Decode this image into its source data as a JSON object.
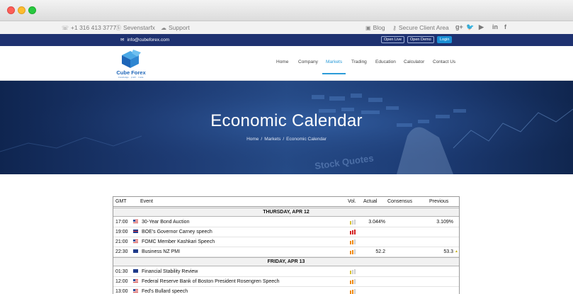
{
  "topbar": {
    "phone": "+1 316 413 3777",
    "skype": "Sevenstarfx",
    "support": "Support",
    "blog": "Blog",
    "secure": "Secure Client Area",
    "social": [
      "g+",
      "twitter-icon",
      "youtube-icon",
      "in",
      "f"
    ]
  },
  "bluebar": {
    "email": "info@cubeforex.com",
    "open_live": "Open Live",
    "open_demo": "Open Demo",
    "login": "Login"
  },
  "logo": {
    "name": "Cube Forex",
    "tagline": "knowledge · profit · trade"
  },
  "nav": [
    "Home",
    "Company",
    "Markets",
    "Trading",
    "Education",
    "Calculator",
    "Contact Us"
  ],
  "nav_active": "Markets",
  "hero": {
    "title": "Economic Calendar",
    "breadcrumb": [
      "Home",
      "Markets",
      "Economic Calendar"
    ],
    "bg_text": "Stock Quotes"
  },
  "calendar": {
    "headers": [
      "GMT",
      "Event",
      "Vol.",
      "Actual",
      "Consensus",
      "Previous"
    ],
    "days": [
      {
        "label": "THURSDAY, APR 12",
        "events": [
          {
            "time": "17:00",
            "flag": "us",
            "event": "30-Year Bond Auction",
            "vol": "low",
            "actual": "3.044%",
            "consensus": "",
            "previous": "3.109%"
          },
          {
            "time": "19:00",
            "flag": "gb",
            "event": "BOE's Governor Carney speech",
            "vol": "high",
            "actual": "",
            "consensus": "",
            "previous": ""
          },
          {
            "time": "21:00",
            "flag": "us",
            "event": "FOMC Member Kashkari Speech",
            "vol": "medium",
            "actual": "",
            "consensus": "",
            "previous": ""
          },
          {
            "time": "22:30",
            "flag": "nz",
            "event": "Business NZ PMI",
            "vol": "medium",
            "actual": "52.2",
            "consensus": "",
            "previous": "53.3"
          }
        ]
      },
      {
        "label": "FRIDAY, APR 13",
        "events": [
          {
            "time": "01:30",
            "flag": "au",
            "event": "Financial Stability Review",
            "vol": "low",
            "actual": "",
            "consensus": "",
            "previous": ""
          },
          {
            "time": "12:00",
            "flag": "us",
            "event": "Federal Reserve Bank of Boston President Rosengren Speech",
            "vol": "medium",
            "actual": "",
            "consensus": "",
            "previous": ""
          },
          {
            "time": "13:00",
            "flag": "us",
            "event": "Fed's Bullard speech",
            "vol": "medium",
            "actual": "",
            "consensus": "",
            "previous": ""
          }
        ]
      }
    ]
  },
  "colors": {
    "navy": "#1e3170",
    "accent": "#2b9bd8",
    "vol_high": "#d42121",
    "vol_medium": "#ef8a12",
    "vol_low": "#d9c234"
  }
}
